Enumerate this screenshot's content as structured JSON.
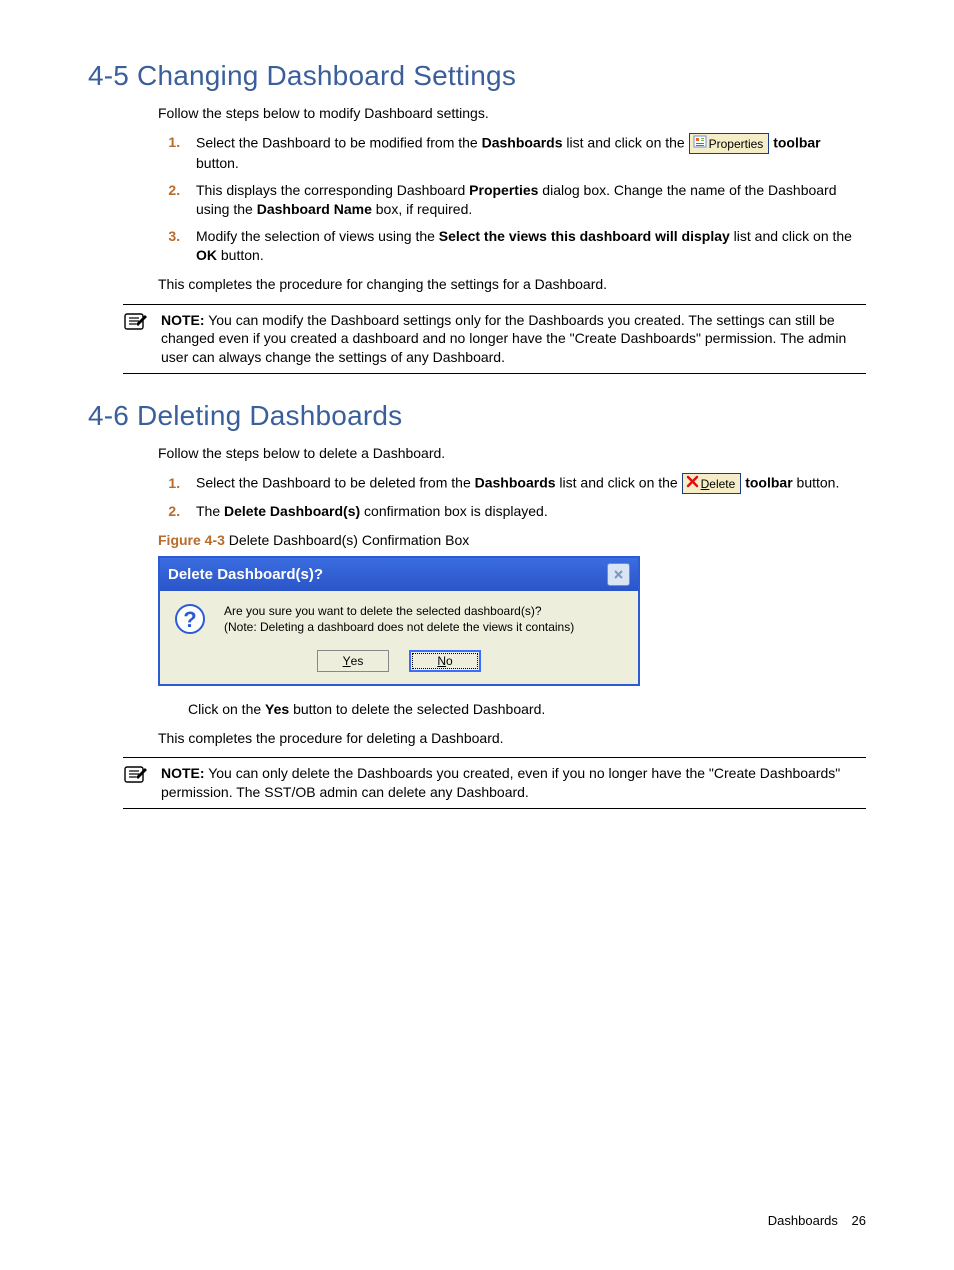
{
  "section45": {
    "heading": "4-5 Changing Dashboard Settings",
    "intro": "Follow the steps below to modify Dashboard settings.",
    "step1_a": "Select the Dashboard to be modified from the ",
    "step1_bold1": "Dashboards",
    "step1_b": " list and click on the ",
    "props_button_label": "Properties",
    "step1_c_bold": "toolbar",
    "step1_c_end": " button.",
    "step2_a": "This displays the corresponding Dashboard ",
    "step2_bold1": "Properties",
    "step2_b": " dialog box.  Change the name of the Dashboard using the ",
    "step2_bold2": "Dashboard Name",
    "step2_c": " box, if required.",
    "step3_a": "Modify the selection of views using the ",
    "step3_bold1": "Select the views this dashboard will display",
    "step3_b": " list and click on the ",
    "step3_bold2": "OK",
    "step3_c": " button.",
    "conclusion": "This completes the procedure for changing the settings for a Dashboard.",
    "note_label": "NOTE:",
    "note_body": "  You can modify the Dashboard settings only for the Dashboards you created.  The settings can still be changed even if you created a dashboard and no longer have the \"Create Dashboards\" permission.  The admin user can always change the settings of any Dashboard."
  },
  "section46": {
    "heading": "4-6 Deleting Dashboards",
    "intro": "Follow the steps below to delete a Dashboard.",
    "step1_a": "Select the Dashboard to be deleted from the ",
    "step1_bold1": "Dashboards",
    "step1_b": " list and click on the ",
    "delete_button_label": "Delete",
    "step1_bold2": "toolbar",
    "step1_c": " button.",
    "step2_a": "The ",
    "step2_bold1": "Delete Dashboard(s)",
    "step2_b": " confirmation box is displayed.",
    "fig_label": "Figure 4-3",
    "fig_text": " Delete Dashboard(s) Confirmation Box",
    "dialog": {
      "title": "Delete Dashboard(s)?",
      "msg_line1": "Are you sure you want to delete the selected dashboard(s)?",
      "msg_line2": "(Note: Deleting a dashboard does not delete the views it contains)",
      "yes": "Yes",
      "no": "No"
    },
    "after_dialog_a": "Click on the ",
    "after_dialog_bold": "Yes",
    "after_dialog_b": " button to delete the selected Dashboard.",
    "conclusion": "This completes the procedure for deleting a Dashboard.",
    "note_label": "NOTE:",
    "note_body": "  You can only delete the Dashboards you created, even if you no longer have the \"Create Dashboards\" permission.  The SST/OB admin can delete any Dashboard."
  },
  "footer": {
    "section": "Dashboards",
    "page": "26"
  }
}
